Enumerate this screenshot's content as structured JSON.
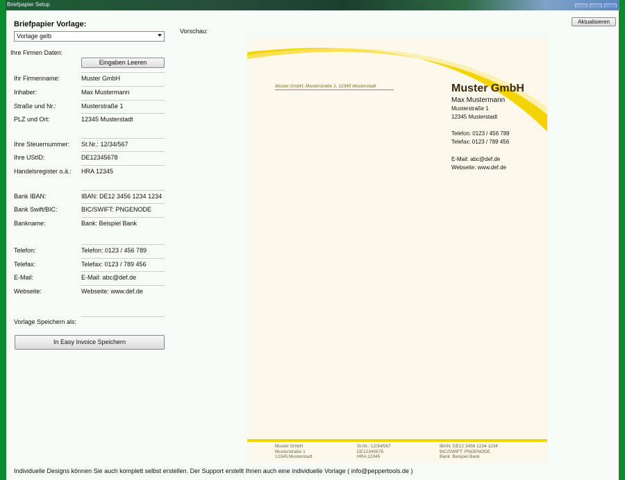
{
  "window": {
    "title": "Briefpapier Setup"
  },
  "left": {
    "heading": "Briefpapier Vorlage:",
    "template_select": "Vorlage gelb",
    "company_data_label": "Ihre Firmen Daten:",
    "clear_button": "Eingaben Leeren",
    "fields": [
      {
        "label": "Ihr Firmenname:",
        "value": "Muster GmbH"
      },
      {
        "label": "Inhaber:",
        "value": "Max Mustermann"
      },
      {
        "label": "Straße und Nr.:",
        "value": "Musterstraße 1"
      },
      {
        "label": "PLZ und Ort:",
        "value": "12345 Musterstadt"
      },
      {
        "label": "Ihre Steuernummer:",
        "value": "St.Nr.: 12/34/567"
      },
      {
        "label": "Ihre UStID:",
        "value": "DE12345678"
      },
      {
        "label": "Handelsregister o.ä.:",
        "value": "HRA 12345"
      },
      {
        "label": "Bank IBAN:",
        "value": "IBAN: DE12 3456 1234 1234"
      },
      {
        "label": "Bank Swift/BIC:",
        "value": "BIC/SWIFT: PNGENODE"
      },
      {
        "label": "Bankname:",
        "value": "Bank: Beispiel Bank"
      },
      {
        "label": "Telefon:",
        "value": "Telefon: 0123 / 456 789"
      },
      {
        "label": "Telefax:",
        "value": "Telefax: 0123 / 789 456"
      },
      {
        "label": "E-Mail:",
        "value": "E-Mail: abc@def.de"
      },
      {
        "label": "Webseite:",
        "value": "Webseite: www.def.de"
      }
    ],
    "save_as_label": "Vorlage Speichern als:",
    "save_button": "In Easy Invoice Speichern"
  },
  "preview": {
    "label": "Vorschau:",
    "refresh_button": "Aktualisieren",
    "sender_line": "Muster GmbH, Musterstraße 1, 12345 Musterstadt",
    "company": "Muster GmbH",
    "owner": "Max Mustermann",
    "street": "Musterstraße 1",
    "city": "12345 Musterstadt",
    "phone": "Telefon: 0123 / 456 789",
    "fax": "Telefax: 0123 / 789 456",
    "email": "E-Mail: abc@def.de",
    "web": "Webseite: www.def.de",
    "footer": {
      "col1": [
        "Muster GmbH",
        "Musterstraße 1",
        "12345 Musterstadt"
      ],
      "col2": [
        "St.Nr.: 12/34/567",
        "DE12345678",
        "HRA 12345"
      ],
      "col3": [
        "IBAN: DE12 3456 1234 1234",
        "BIC/SWIFT: PNGENODE",
        "Bank: Beispiel Bank"
      ]
    },
    "accent_color": "#f2d400"
  },
  "bottom_note": "Individuelle Designs können Sie auch komplett selbst erstellen. Der Support erstellt Ihnen auch eine individuelle Vorlage ( info@peppertools.de )"
}
